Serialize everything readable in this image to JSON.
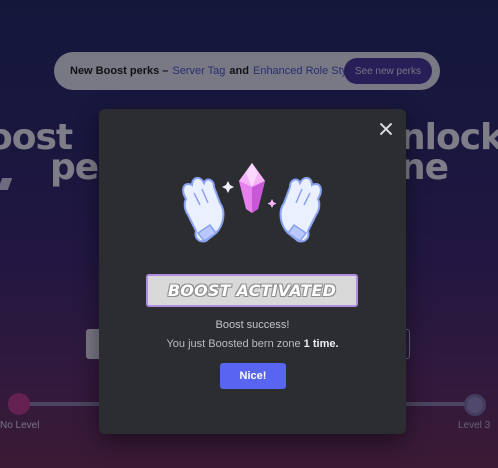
{
  "background": {
    "banner": {
      "lead": "New Boost perks –",
      "link_server_tag": "Server Tag",
      "and_text": "and",
      "link_role_styles": "Enhanced Role Styles",
      "see_button": "See new perks"
    },
    "hero_fragments": [
      "oost",
      "nlock",
      "pe",
      "ne"
    ],
    "level_left_label": "No Level",
    "level_right_label": "Level 3"
  },
  "modal": {
    "close_icon": "close-icon",
    "banner_text": "BOOST ACTIVATED",
    "title": "Boost success!",
    "message_prefix": "You just Boosted bern zone",
    "message_count": "1 time.",
    "button_label": "Nice!",
    "colors": {
      "button": "#5865f2",
      "crystal": "#e880f0",
      "gloves": "#eaf0ff",
      "banner_border": "#b08de0"
    }
  }
}
